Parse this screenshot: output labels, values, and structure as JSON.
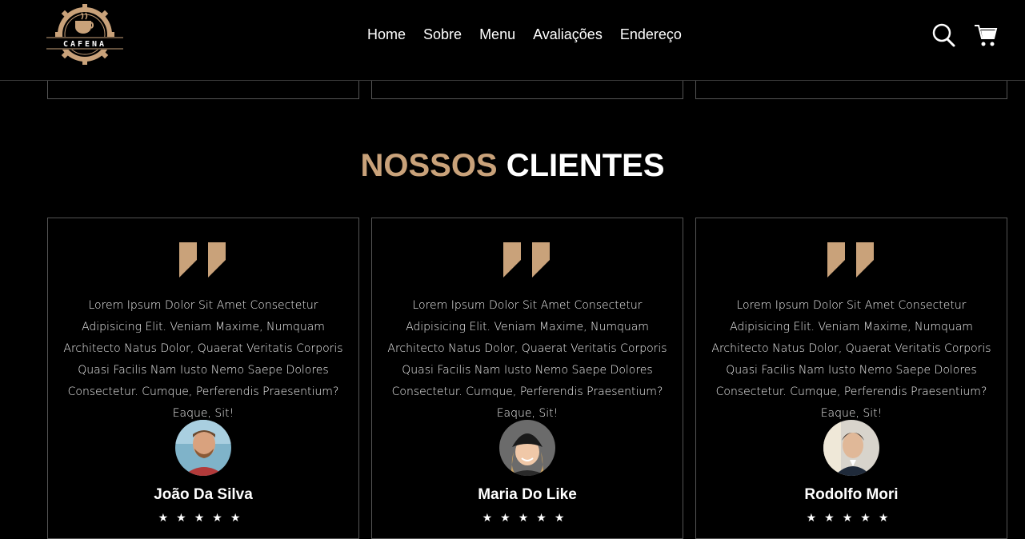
{
  "brand": {
    "logo_text": "CAFENA"
  },
  "nav": {
    "items": [
      "Home",
      "Sobre",
      "Menu",
      "Avaliações",
      "Endereço"
    ]
  },
  "header_icons": [
    "search-icon",
    "cart-icon"
  ],
  "colors": {
    "accent": "#c9a27a",
    "background": "#000000",
    "border": "#555555"
  },
  "reviews_section": {
    "title_accent": "NOSSOS",
    "title_main": "CLIENTES",
    "cards": [
      {
        "text": "Lorem Ipsum Dolor Sit Amet Consectetur Adipisicing Elit. Veniam Maxime, Numquam Architecto Natus Dolor, Quaerat Veritatis Corporis Quasi Facilis Nam Iusto Nemo Saepe Dolores Consectetur. Cumque, Perferendis Praesentium? Eaque, Sit!",
        "name": "João Da Silva",
        "rating": 5
      },
      {
        "text": "Lorem Ipsum Dolor Sit Amet Consectetur Adipisicing Elit. Veniam Maxime, Numquam Architecto Natus Dolor, Quaerat Veritatis Corporis Quasi Facilis Nam Iusto Nemo Saepe Dolores Consectetur. Cumque, Perferendis Praesentium? Eaque, Sit!",
        "name": "Maria Do Like",
        "rating": 5
      },
      {
        "text": "Lorem Ipsum Dolor Sit Amet Consectetur Adipisicing Elit. Veniam Maxime, Numquam Architecto Natus Dolor, Quaerat Veritatis Corporis Quasi Facilis Nam Iusto Nemo Saepe Dolores Consectetur. Cumque, Perferendis Praesentium? Eaque, Sit!",
        "name": "Rodolfo Mori",
        "rating": 5
      }
    ]
  }
}
